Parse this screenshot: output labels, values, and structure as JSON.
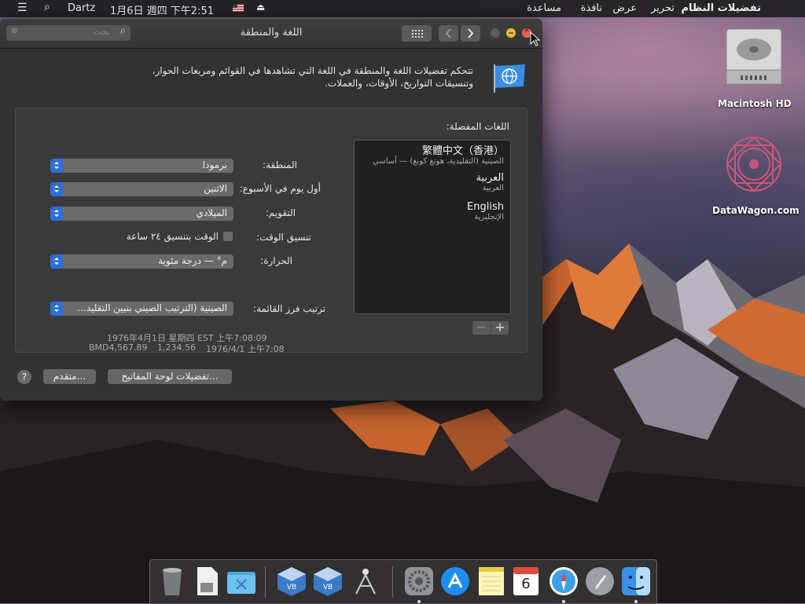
{
  "menubar": {
    "left_app": "Dartz",
    "clock": "1月6日 週四 下午2:51",
    "items": [
      "تفضيلات النظام",
      "تحرير",
      "عرض",
      "نافذة",
      "مساعدة"
    ]
  },
  "window": {
    "title": "اللغة والمنطقة",
    "search_placeholder": "بحث"
  },
  "header": {
    "description_line1": "تتحكم تفضيلات اللغة والمنطقة في اللغة التي تشاهدها في القوائم ومربعات الحوار،",
    "description_line2": "وتنسيقات التواريخ، الأوقات، والعملات."
  },
  "languages": {
    "label": "اللغات المفضلة:",
    "items": [
      {
        "name": "繁體中文（香港）",
        "sub": "الصينية (التقليدية، هونغ كونغ) — أساسي"
      },
      {
        "name": "العربية",
        "sub": "العربية"
      },
      {
        "name": "English",
        "sub": "الإنجليزية"
      }
    ],
    "add": "+",
    "remove": "−"
  },
  "settings": {
    "region_label": "المنطقة:",
    "region_value": "برمودا",
    "first_day_label": "أول يوم في الأسبوع:",
    "first_day_value": "الاثنين",
    "calendar_label": "التقويم:",
    "calendar_value": "الميلادي",
    "time_format_label": "تنسيق الوقت:",
    "time_format_checkbox": "الوقت بتنسيق ٢٤ ساعة",
    "temperature_label": "الحرارة:",
    "temperature_value": "م° — درجة مئوية",
    "sort_label": "ترتيب فرز القائمة:",
    "sort_value": "الصينية (الترتيب الصيني بنيين التقليد..."
  },
  "samples": {
    "line1": "1976年4月1日 星期四 EST 上午7:08:09",
    "line2_left": "BMD4,567.89",
    "line2_mid": "1,234.56",
    "line2_right": "1976/4/1 上午7:08"
  },
  "buttons": {
    "keyboard_prefs": "تفضيلات لوحة المفاتيح...",
    "advanced": "متقدم...",
    "help": "?"
  },
  "desktop": {
    "icons": [
      {
        "label": "Macintosh HD",
        "icon": "hard-drive-icon"
      },
      {
        "label": "DataWagon.com",
        "icon": "datawagon-logo-icon"
      }
    ]
  },
  "dock": {
    "apps": [
      "trash-icon",
      "documents-icon",
      "downloads-folder-icon",
      "virtualbox-icon",
      "virtualbox-icon",
      "network-utility-icon",
      "system-preferences-icon",
      "app-store-icon",
      "notes-icon",
      "calendar-icon",
      "safari-icon",
      "launchpad-icon",
      "finder-icon"
    ],
    "calendar_day": "6"
  },
  "colors": {
    "accent": "#2d6fd6",
    "close": "#ec5f56",
    "minimize": "#e9b93c",
    "window_bg": "#323232"
  }
}
